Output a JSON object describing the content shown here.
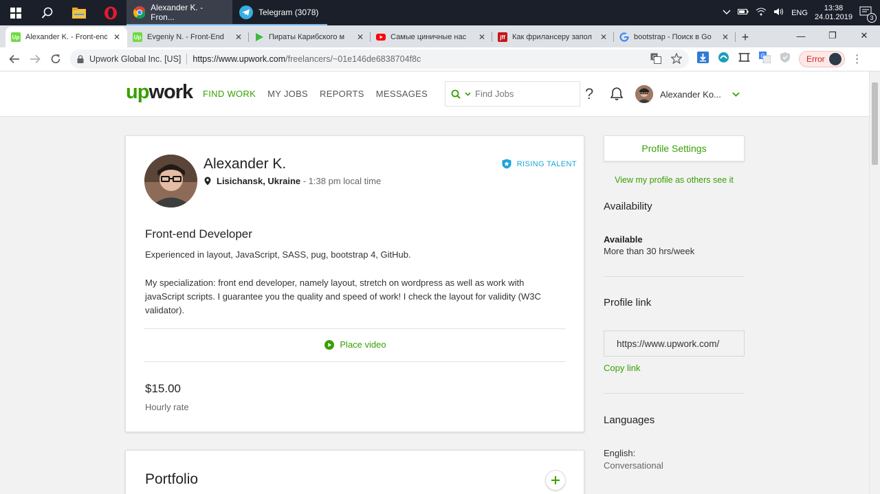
{
  "taskbar": {
    "apps": [
      {
        "label": "Alexander K. - Fron..."
      },
      {
        "label": "Telegram (3078)",
        "badge": "78"
      }
    ],
    "lang": "ENG",
    "time": "13:38",
    "date": "24.01.2019",
    "notifications": "3"
  },
  "tabs": [
    {
      "title": "Alexander K. - Front-end",
      "favicon": "upwork",
      "active": true
    },
    {
      "title": "Evgeniy N. - Front-End",
      "favicon": "upwork"
    },
    {
      "title": "Пираты Карибского м",
      "favicon": "play"
    },
    {
      "title": "Самые циничные нас",
      "favicon": "youtube"
    },
    {
      "title": "Как фрилансеру запол",
      "favicon": "jff"
    },
    {
      "title": "bootstrap - Поиск в Go",
      "favicon": "google"
    }
  ],
  "omnibox": {
    "org": "Upwork Global Inc. [US]",
    "host": "https://www.upwork.com",
    "path": "/freelancers/~01e146de6838704f8c"
  },
  "error_label": "Error",
  "header": {
    "logo_up": "up",
    "logo_work": "work",
    "nav": [
      "FIND WORK",
      "MY JOBS",
      "REPORTS",
      "MESSAGES"
    ],
    "search_placeholder": "Find Jobs",
    "help": "?",
    "user_name": "Alexander Ko..."
  },
  "profile": {
    "name": "Alexander K.",
    "location": "Lisichansk, Ukraine",
    "local_time": " - 1:38 pm local time",
    "badge": "RISING TALENT",
    "title": "Front-end Developer",
    "desc1": "Experienced in layout, JavaScript, SASS, pug, bootstrap 4, GitHub.",
    "desc2": "My specialization: front end developer, namely layout, stretch on wordpress as well as work with javaScript scripts. I guarantee you the quality and speed of work! I check the layout for validity (W3C validator).",
    "video": "Place video",
    "rate": "$15.00",
    "rate_label": "Hourly rate"
  },
  "portfolio": {
    "title": "Portfolio"
  },
  "sidebar": {
    "settings": "Profile Settings",
    "view_as": "View my profile as others see it",
    "availability_head": "Availability",
    "availability_status": "Available",
    "availability_hours": "More than 30 hrs/week",
    "link_head": "Profile link",
    "link_value": "https://www.upwork.com/",
    "copy": "Copy link",
    "languages_head": "Languages",
    "lang_name": "English:",
    "lang_level": "Conversational"
  },
  "colors": {
    "brand_green": "#37a000",
    "rising_blue": "#1ca4d8"
  }
}
